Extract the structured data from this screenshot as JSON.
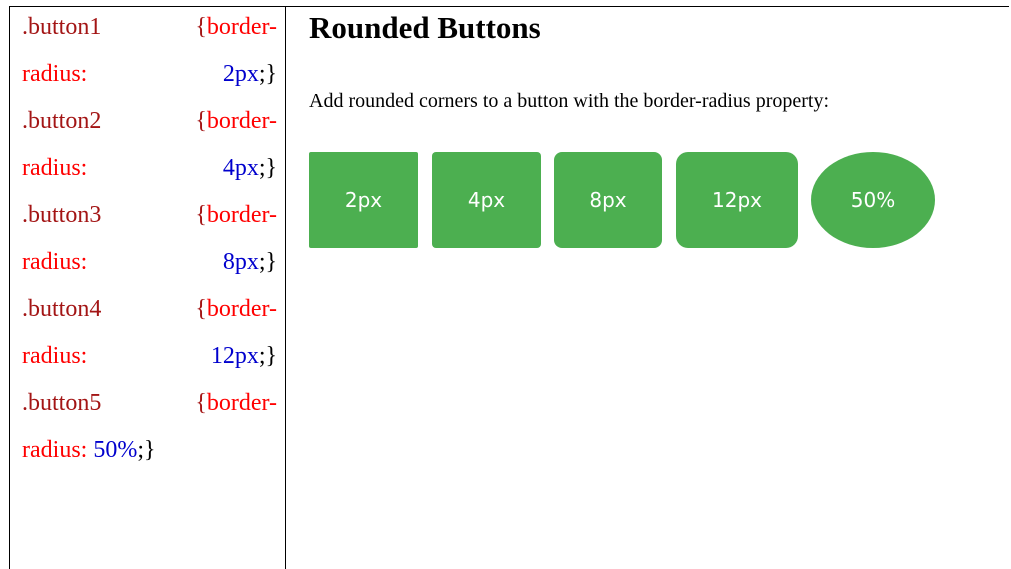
{
  "code_lines": [
    {
      "sel": ".button1",
      "open": "{",
      "prop": "border-"
    },
    {
      "prop2": "radius:",
      "val": "2px",
      "close": ";}"
    },
    {
      "sel": ".button2",
      "open": "{",
      "prop": "border-"
    },
    {
      "prop2": "radius:",
      "val": "4px",
      "close": ";}"
    },
    {
      "sel": ".button3",
      "open": "{",
      "prop": "border-"
    },
    {
      "prop2": "radius:",
      "val": "8px",
      "close": ";}"
    },
    {
      "sel": ".button4",
      "open": "{",
      "prop": "border-"
    },
    {
      "prop2": "radius:",
      "val": "12px",
      "close": ";}"
    },
    {
      "sel": ".button5",
      "open": "{",
      "prop": "border-"
    },
    {
      "prop2": "radius:",
      "val": "50%",
      "close": ";}"
    }
  ],
  "demo": {
    "heading": "Rounded Buttons",
    "description": "Add rounded corners to a button with the border-radius property:",
    "buttons": [
      {
        "label": "2px"
      },
      {
        "label": "4px"
      },
      {
        "label": "8px"
      },
      {
        "label": "12px"
      },
      {
        "label": "50%"
      }
    ]
  },
  "colors": {
    "button_bg": "#4caf50",
    "selector": "#a31515",
    "property": "#ff0000",
    "value": "#0000cd"
  }
}
